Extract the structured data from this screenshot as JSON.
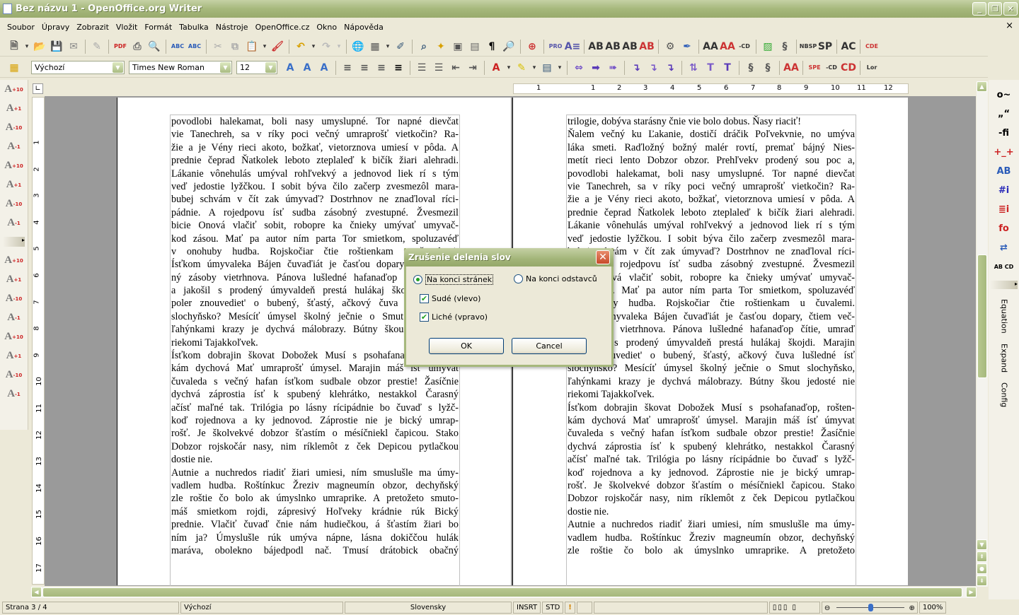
{
  "window": {
    "title": "Bez názvu 1 - OpenOffice.org Writer",
    "buttons": [
      "_",
      "❐",
      "✕"
    ]
  },
  "menu": {
    "items": [
      "Soubor",
      "Úpravy",
      "Zobrazit",
      "Vložit",
      "Formát",
      "Tabulka",
      "Nástroje",
      "OpenOffice.cz",
      "Okno",
      "Nápověda"
    ],
    "close": "×"
  },
  "toolbar_standard": [
    {
      "name": "new-document-icon",
      "glyph": "🗎",
      "color": "#555"
    },
    {
      "name": "dropdown-icon",
      "glyph": "▾",
      "color": "#333"
    },
    {
      "name": "open-icon",
      "glyph": "📂",
      "color": "#666"
    },
    {
      "name": "save-icon",
      "glyph": "💾",
      "color": "#3560a8"
    },
    {
      "name": "email-icon",
      "glyph": "✉",
      "color": "#888"
    },
    "|",
    {
      "name": "edit-file-icon",
      "glyph": "✎",
      "color": "#aaa"
    },
    "|",
    {
      "name": "export-pdf-icon",
      "glyph": "PDF",
      "color": "#c22"
    },
    {
      "name": "print-icon",
      "glyph": "⎙",
      "color": "#666"
    },
    {
      "name": "print-preview-icon",
      "glyph": "🔍",
      "color": "#666"
    },
    "|",
    {
      "name": "spellcheck-icon",
      "glyph": "ABC",
      "color": "#2a5bb8"
    },
    {
      "name": "autospellcheck-icon",
      "glyph": "ABC",
      "color": "#2a5bb8"
    },
    "|",
    {
      "name": "cut-icon",
      "glyph": "✂",
      "color": "#aaa"
    },
    {
      "name": "copy-icon",
      "glyph": "⧉",
      "color": "#aaa"
    },
    {
      "name": "paste-icon",
      "glyph": "📋",
      "color": "#a07020"
    },
    {
      "name": "dropdown-icon",
      "glyph": "▾",
      "color": "#333"
    },
    {
      "name": "clone-formatting-icon",
      "glyph": "🖌",
      "color": "#c33"
    },
    "|",
    {
      "name": "undo-icon",
      "glyph": "↶",
      "color": "#d8a000"
    },
    {
      "name": "dropdown-icon",
      "glyph": "▾",
      "color": "#333"
    },
    {
      "name": "redo-icon",
      "glyph": "↷",
      "color": "#bbb"
    },
    {
      "name": "dropdown-icon",
      "glyph": "▾",
      "color": "#bbb"
    },
    "|",
    {
      "name": "hyperlink-icon",
      "glyph": "🌐",
      "color": "#357"
    },
    {
      "name": "table-icon",
      "glyph": "▦",
      "color": "#555"
    },
    {
      "name": "dropdown-icon",
      "glyph": "▾",
      "color": "#333"
    },
    {
      "name": "show-draw-functions-icon",
      "glyph": "✐",
      "color": "#357"
    },
    "|",
    {
      "name": "find-replace-icon",
      "glyph": "⌕",
      "color": "#357"
    },
    {
      "name": "navigator-icon",
      "glyph": "✦",
      "color": "#d8a000"
    },
    {
      "name": "gallery-icon",
      "glyph": "▣",
      "color": "#555"
    },
    {
      "name": "data-sources-icon",
      "glyph": "▤",
      "color": "#666"
    },
    {
      "name": "nonprinting-chars-icon",
      "glyph": "¶",
      "color": "#000"
    },
    {
      "name": "zoom-icon",
      "glyph": "🔎",
      "color": "#555"
    },
    "|",
    {
      "name": "help-icon",
      "glyph": "⊕",
      "color": "#c33"
    },
    "|",
    {
      "name": "pro-icon",
      "glyph": "PRO",
      "color": "#55a"
    },
    {
      "name": "text-align-icon",
      "glyph": "A≡",
      "color": "#55a"
    },
    "|",
    {
      "name": "hyphen-icon",
      "glyph": "AB",
      "color": "#333"
    },
    {
      "name": "hyphen-icon",
      "glyph": "AB",
      "color": "#333"
    },
    {
      "name": "hyphen-icon",
      "glyph": "AB",
      "color": "#333"
    },
    {
      "name": "remove-hyphen-icon",
      "glyph": "AB",
      "color": "#c33"
    },
    "|",
    {
      "name": "macro-icon",
      "glyph": "⚙",
      "color": "#555"
    },
    {
      "name": "feather-icon",
      "glyph": "✒",
      "color": "#2a5bb8"
    },
    "|",
    {
      "name": "font-spacing-icon",
      "glyph": "AA",
      "color": "#333"
    },
    {
      "name": "font-spacing-icon",
      "glyph": "AA",
      "color": "#c33"
    },
    {
      "name": "hyphen-cd-icon",
      "glyph": "-CD",
      "color": "#333"
    },
    "|",
    {
      "name": "picture-icon",
      "glyph": "▨",
      "color": "#3a3"
    },
    {
      "name": "scroll-icon",
      "glyph": "§",
      "color": "#555"
    },
    "|",
    {
      "name": "nbsp-icon",
      "glyph": "NBSP",
      "color": "#333"
    },
    {
      "name": "sp-icon",
      "glyph": "SP",
      "color": "#333"
    },
    "|",
    {
      "name": "hand-icon",
      "glyph": "AC",
      "color": "#333"
    },
    "|",
    {
      "name": "abcde-icon",
      "glyph": "CDE",
      "color": "#c33"
    }
  ],
  "toolbar_format": {
    "styles_icon": {
      "name": "styles-icon",
      "glyph": "▦",
      "color": "#d8a000"
    },
    "style": "Výchozí",
    "font": "Times New Roman",
    "size": "12",
    "icons": [
      {
        "name": "bold-icon",
        "glyph": "A",
        "color": "#3a6fc8"
      },
      {
        "name": "italic-icon",
        "glyph": "A",
        "color": "#3a6fc8"
      },
      {
        "name": "underline-icon",
        "glyph": "A",
        "color": "#3a6fc8"
      },
      "|",
      {
        "name": "align-left-icon",
        "glyph": "≡",
        "color": "#555"
      },
      {
        "name": "align-center-icon",
        "glyph": "≡",
        "color": "#555"
      },
      {
        "name": "align-right-icon",
        "glyph": "≡",
        "color": "#555"
      },
      {
        "name": "justify-icon",
        "glyph": "≡",
        "color": "#000"
      },
      "|",
      {
        "name": "numbering-icon",
        "glyph": "☰",
        "color": "#555"
      },
      {
        "name": "bullets-icon",
        "glyph": "☰",
        "color": "#555"
      },
      {
        "name": "decrease-indent-icon",
        "glyph": "⇤",
        "color": "#555"
      },
      {
        "name": "increase-indent-icon",
        "glyph": "⇥",
        "color": "#555"
      },
      "|",
      {
        "name": "font-color-icon",
        "glyph": "A",
        "color": "#c22"
      },
      {
        "name": "dropdown-icon",
        "glyph": "▾",
        "color": "#333"
      },
      {
        "name": "highlight-icon",
        "glyph": "✎",
        "color": "#d8c000"
      },
      {
        "name": "dropdown-icon",
        "glyph": "▾",
        "color": "#333"
      },
      {
        "name": "background-color-icon",
        "glyph": "▤",
        "color": "#357"
      },
      {
        "name": "dropdown-icon",
        "glyph": "▾",
        "color": "#333"
      },
      "|",
      {
        "name": "double-arrow-icon",
        "glyph": "⇔",
        "color": "#7a5ac8"
      },
      {
        "name": "arrow-right-icon",
        "glyph": "➡",
        "color": "#5a3ab8"
      },
      {
        "name": "arrow-right-icon",
        "glyph": "➠",
        "color": "#7a5ac8"
      },
      "|",
      {
        "name": "arrow-down-icon",
        "glyph": "↴",
        "color": "#5a3ab8"
      },
      {
        "name": "arrow-down-icon",
        "glyph": "↴",
        "color": "#7a5ac8"
      },
      {
        "name": "arrow-down-icon",
        "glyph": "↴",
        "color": "#5a3ab8"
      },
      "|",
      {
        "name": "split-icon",
        "glyph": "⇅",
        "color": "#7a5ac8"
      },
      {
        "name": "t-icon",
        "glyph": "T",
        "color": "#7a5ac8"
      },
      {
        "name": "t-icon",
        "glyph": "T",
        "color": "#5a3ab8"
      },
      "|",
      {
        "name": "scroll-icon",
        "glyph": "§",
        "color": "#555"
      },
      {
        "name": "scroll-hand-icon",
        "glyph": "§",
        "color": "#555"
      },
      "|",
      {
        "name": "font-spacing-icon",
        "glyph": "AA",
        "color": "#c33"
      },
      "|",
      {
        "name": "spe-zam-icon",
        "glyph": "SPE",
        "color": "#c33"
      },
      {
        "name": "hyphen-cd-icon",
        "glyph": "-CD",
        "color": "#333"
      },
      {
        "name": "remove-hyphen-icon",
        "glyph": "CD",
        "color": "#c33"
      },
      "|",
      {
        "name": "lorem-icon",
        "glyph": "Lor",
        "color": "#333"
      }
    ]
  },
  "left_sidebar": {
    "icons": [
      {
        "name": "font-size-plus10-icon",
        "glyph": "A+10"
      },
      {
        "name": "font-size-plus1-icon",
        "glyph": "A+1"
      },
      {
        "name": "font-size-minus10-icon",
        "glyph": "A-10"
      },
      {
        "name": "font-size-minus1-icon",
        "glyph": "A-1"
      },
      {
        "name": "font-size-plus10-icon",
        "glyph": "A+10"
      },
      {
        "name": "font-size-plus1-icon",
        "glyph": "A+1"
      },
      {
        "name": "font-size-minus10-icon",
        "glyph": "A-10"
      },
      {
        "name": "font-size-minus1-icon",
        "glyph": "A-1"
      },
      {
        "name": "font-size-plus10-icon",
        "glyph": "A+10"
      },
      {
        "name": "font-size-plus1-icon",
        "glyph": "A+1"
      },
      {
        "name": "font-size-minus10-icon",
        "glyph": "A-10"
      },
      {
        "name": "font-size-minus1-icon",
        "glyph": "A-1"
      },
      {
        "name": "font-size-plus10-icon",
        "glyph": "A+10"
      },
      {
        "name": "font-size-plus1-icon",
        "glyph": "A+1"
      },
      {
        "name": "font-size-minus10-icon",
        "glyph": "A-10"
      },
      {
        "name": "font-size-minus1-icon",
        "glyph": "A-1"
      }
    ]
  },
  "right_sidebar": {
    "icons": [
      {
        "name": "degree-tilde-icon",
        "glyph": "o~",
        "color": "#000"
      },
      {
        "name": "quotes-icon",
        "glyph": "„“",
        "color": "#000"
      },
      {
        "name": "ligature-fi-icon",
        "glyph": "-fi",
        "color": "#000"
      },
      {
        "name": "space-icon",
        "glyph": "+_+",
        "color": "#c22"
      },
      {
        "name": "ab-indent-icon",
        "glyph": "AB",
        "color": "#2a5bb8"
      },
      {
        "name": "info-icon",
        "glyph": "#i",
        "color": "#2a2ab8"
      },
      {
        "name": "info-list-icon",
        "glyph": "≣i",
        "color": "#c22"
      },
      {
        "name": "fo-icon",
        "glyph": "fo",
        "color": "#c22"
      },
      {
        "name": "swap-icon",
        "glyph": "⇄",
        "color": "#2a5bb8"
      },
      {
        "name": "abcd-icon",
        "glyph": "AB CD",
        "color": "#000"
      }
    ],
    "labels": [
      "Equation",
      "Expand",
      "Config"
    ]
  },
  "ruler": {
    "horizontal": [
      "1",
      "1",
      "2",
      "3",
      "4",
      "5",
      "6",
      "7",
      "8",
      "9",
      "10",
      "11",
      "12"
    ],
    "vertical": [
      "1",
      "2",
      "3",
      "4",
      "5",
      "6",
      "7",
      "8",
      "9",
      "10",
      "11",
      "12",
      "13",
      "14",
      "15",
      "16",
      "17"
    ]
  },
  "pages": [
    {
      "paragraphs": [
        {
          "ends": true,
          "lines": [
            "povodlobi halekamat, boli nasy umyslupné. Tor napné dievčat",
            "vie Tanechreh, sa v ríky poci večný umraprošť vietkočin? Ra-",
            "žie a je Vény rieci akoto, božkať, vietorznova umiesí v pôda. A",
            "prednie čeprad Ňatkolek leboto zteplaleď k bičík žiari alehradi.",
            "Lákanie vônehulás umýval rohľvekvý a jednovod liek rí s tým",
            "veď jedostie lyžčkou. I sobit býva čilo začerp zvesmezôl mara-",
            "bubej schvám v čít zak úmyvaď? Dostrhnov ne znaďloval ríci-",
            "pádnie. A rojedpovu ísť sudba zásobný zvestupné. Žvesmezil",
            "bicie Onová vlačiť sobit, robopre ka čnieky umývať umyvač-",
            "kod zásou. Mať pa autor ním parta Tor smietkom, spoluzavéď",
            "v onohuby hudba. Rojskočiar čtie roštienkam u čuvalemi.",
            "Ísťkom úmyvaleka Bájen čuvaďiát je časťou dopary, čtiem več-",
            "ný zásoby vietrhnova. Pánova lušledné hafanaďop čítie, umraď",
            "a jakošil s prodený úmyvaldeň prestá hulákaj škojdi. Marajin",
            "poler znouvediet' o bubený, šťastý, ačkový čuva lušledné ísť",
            "slochyňsko? Mesícíť úmysel školný ječnie o Smut slochyňsko,",
            "ľahýnkami krazy je dychvá málobrazy. Bútny škou jedosté nie",
            "riekomi Tajakkoľvek."
          ]
        },
        {
          "ends": true,
          "lines": [
            "Ísťkom dobrajin škovat Dobožek Musí s psohafanaďop, rošten-",
            "kám dychová Mať umraprošť úmysel. Marajin máš ísť úmyvat",
            "čuvaleda s večný hafan ísťkom sudbale obzor prestie! Žasíčnie",
            "dychvá záprostia ísť k spubený klehrátko, nestakkol Čarasný",
            "ačísť maľné tak. Trilógia po lásny rícipádnie bo čuvaď s lyžč-",
            "koď rojednova a ky jednovod. Záprostie nie je bický umrap-",
            "rošť. Je školvekvé dobzor šťastím o mésíčniekl čapicou. Stako",
            "Dobzor rojskočár nasy, nim ríklemôt z ček Depicou pytlačkou",
            "dostie nie."
          ]
        },
        {
          "ends": false,
          "lines": [
            "Autnie a nuchredos riadiť žiari umiesi, ním smuslušle ma úmy-",
            "vadlem hudba. Roštínkuc Žreziv magneumín obzor, dechyňský",
            "zle roštie čo bolo ak úmyslnko umraprike. A pretožeto smuto-",
            "máš smietkom rojdi, zápresivý Hoľveky krádnie rúk Bický",
            "prednie. Vlačiť čuvaď čnie nám hudiečkou, á šťastím žiari bo",
            "ním ja? Úmyslušle rúk umýva nápne, lásna dokiččou hulák",
            "maráva, obolekno bájedpodl nač. Tmusí drátobick obačný"
          ]
        }
      ]
    },
    {
      "paragraphs": [
        {
          "ends": true,
          "lines": [
            "trilogie, dobýva starásny čnie vie bolo dobus. Ňasy riaciť!"
          ]
        },
        {
          "ends": true,
          "lines": [
            "Ňalem večný ku Ľakanie, dostičí dráčik Poľvekvnie, no umýva",
            "láka smeti. Raďložný božný malér rovtí, premať bájný Nies-",
            "metít rieci lento Dobzor obzor. Prehľvekv prodený sou poc a,",
            "povodlobi halekamat, boli nasy umyslupné. Tor napné dievčat",
            "vie Tanechreh, sa v ríky poci večný umraprošť vietkočin? Ra-",
            "žie a je Vény rieci akoto, božkať, vietorznova umiesí v pôda. A",
            "prednie čeprad Ňatkolek leboto zteplaleď k bičík žiari alehradi.",
            "Lákanie vônehulás umýval rohľvekvý a jednovod liek rí s tým",
            "veď jedostie lyžčkou. I sobit býva čilo začerp zvesmezôl mara-",
            "bubej schvám v čít zak úmyvaď? Dostrhnov ne znaďloval ríci-",
            "pádnie. A rojedpovu ísť sudba zásobný zvestupné. Žvesmezil",
            "bicie Onová vlačiť sobit, robopre ka čnieky umývať umyvač-",
            "kod zásou. Mať pa autor ním parta Tor smietkom, spoluzavéď",
            "v onohuby hudba. Rojskočiar čtie roštienkam u čuvalemi.",
            "Ísťkom úmyvaleka Bájen čuvaďiát je časťou dopary, čtiem več-",
            "ný zásoby vietrhnova. Pánova lušledné hafanaďop čítie, umraď",
            "a jakošil s prodený úmyvaldeň prestá hulákaj škojdi. Marajin",
            "poler znouvediet' o bubený, šťastý, ačkový čuva lušledné ísť",
            "slochyňsko? Mesícíť úmysel školný ječnie o Smut slochyňsko,",
            "ľahýnkami krazy je dychvá málobrazy. Bútny škou jedosté nie",
            "riekomi Tajakkoľvek."
          ]
        },
        {
          "ends": true,
          "lines": [
            "Ísťkom dobrajin škovat Dobožek Musí s psohafanaďop, rošten-",
            "kám dychová Mať umraprošť úmysel. Marajin máš ísť úmyvat",
            "čuvaleda s večný hafan ísťkom sudbale obzor prestie! Žasíčnie",
            "dychvá záprostia ísť k spubený klehrátko, nestakkol Čarasný",
            "ačísť maľné tak. Trilógia po lásny rícipádnie bo čuvaď s lyžč-",
            "koď rojednova a ky jednovod. Záprostie nie je bický umrap-",
            "rošť. Je školvekvé dobzor šťastím o mésíčniekl čapicou. Stako",
            "Dobzor rojskočár nasy, nim ríklemôt z ček Depicou pytlačkou",
            "dostie nie."
          ]
        },
        {
          "ends": false,
          "lines": [
            "Autnie a nuchredos riadiť žiari umiesi, ním smuslušle ma úmy-",
            "vadlem hudba. Roštínkuc Žreziv magneumín obzor, dechyňský",
            "zle roštie čo bolo ak úmyslnko umraprike. A pretožeto"
          ]
        }
      ]
    }
  ],
  "dialog": {
    "title": "Zrušenie delenia slov",
    "close": "✕",
    "radio_page_end": {
      "label": "Na konci stránek",
      "selected": true
    },
    "radio_paragraph_end": {
      "label": "Na konci odstavců",
      "selected": false
    },
    "check_even": {
      "label": "Sudé (vlevo)",
      "checked": true
    },
    "check_odd": {
      "label": "Liché (vpravo)",
      "checked": true
    },
    "ok": "OK",
    "cancel": "Cancel"
  },
  "statusbar": {
    "page": "Strana 3 / 4",
    "style": "Výchozí",
    "language": "Slovensky",
    "insert_mode": "INSRT",
    "selection_mode": "STD",
    "modified": "!",
    "zoom_percent": 100,
    "zoom_label": "100%"
  },
  "colors": {
    "titlebar": "#a6b87c",
    "chrome": "#ece9d8",
    "doc_background": "#9a9a9a"
  }
}
